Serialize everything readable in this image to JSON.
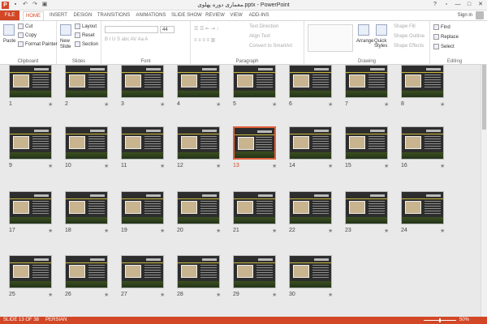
{
  "window": {
    "title": "معماری دوره پهلوی.pptx - PowerPoint",
    "app_icon": "P",
    "qat_icons": [
      "save-icon",
      "undo-icon",
      "redo-icon",
      "present-icon"
    ],
    "controls": [
      "?",
      "▫",
      "—",
      "□",
      "✕"
    ]
  },
  "tabs": [
    {
      "label": "FILE"
    },
    {
      "label": "HOME"
    },
    {
      "label": "INSERT"
    },
    {
      "label": "DESIGN"
    },
    {
      "label": "TRANSITIONS"
    },
    {
      "label": "ANIMATIONS"
    },
    {
      "label": "SLIDE SHOW"
    },
    {
      "label": "REVIEW"
    },
    {
      "label": "VIEW"
    },
    {
      "label": "ADD-INS"
    }
  ],
  "account": {
    "signin": "Sign in"
  },
  "ribbon": {
    "clipboard": {
      "label": "Clipboard",
      "paste": "Paste",
      "cut": "Cut",
      "copy": "Copy",
      "format_painter": "Format Painter"
    },
    "slides": {
      "label": "Slides",
      "new_slide": "New",
      "new_slide2": "Slide",
      "layout": "Layout",
      "reset": "Reset",
      "section": "Section"
    },
    "font": {
      "label": "Font",
      "size": "44"
    },
    "paragraph": {
      "label": "Paragraph",
      "text_direction": "Text Direction",
      "align_text": "Align Text",
      "smartart": "Convert to SmartArt"
    },
    "drawing": {
      "label": "Drawing",
      "arrange": "Arrange",
      "quick_styles": "Quick Styles",
      "shape_fill": "Shape Fill",
      "shape_outline": "Shape Outline",
      "shape_effects": "Shape Effects"
    },
    "editing": {
      "label": "Editing",
      "find": "Find",
      "replace": "Replace",
      "select": "Select"
    }
  },
  "slides": [
    {
      "n": "1"
    },
    {
      "n": "2"
    },
    {
      "n": "3"
    },
    {
      "n": "4"
    },
    {
      "n": "5"
    },
    {
      "n": "6"
    },
    {
      "n": "7"
    },
    {
      "n": "8"
    },
    {
      "n": "9"
    },
    {
      "n": "10"
    },
    {
      "n": "11"
    },
    {
      "n": "12"
    },
    {
      "n": "13"
    },
    {
      "n": "14"
    },
    {
      "n": "15"
    },
    {
      "n": "16"
    },
    {
      "n": "17"
    },
    {
      "n": "18"
    },
    {
      "n": "19"
    },
    {
      "n": "20"
    },
    {
      "n": "21"
    },
    {
      "n": "22"
    },
    {
      "n": "23"
    },
    {
      "n": "24"
    },
    {
      "n": "25"
    },
    {
      "n": "26"
    },
    {
      "n": "27"
    },
    {
      "n": "28"
    },
    {
      "n": "29"
    },
    {
      "n": "30"
    }
  ],
  "selected_slide": "13",
  "status": {
    "slide": "SLIDE 13 OF 38",
    "language": "PERSIAN",
    "zoom": "50%"
  },
  "colors": {
    "accent": "#d24726"
  }
}
